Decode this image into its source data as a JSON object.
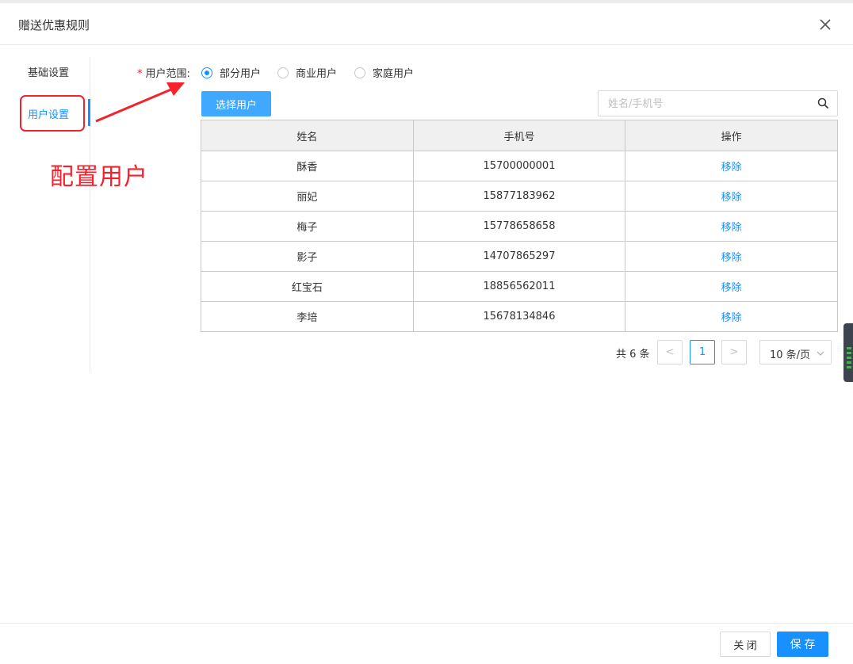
{
  "dialog": {
    "title": "赠送优惠规则",
    "close_icon": "close-icon"
  },
  "tabs": [
    {
      "label": "基础设置",
      "active": false
    },
    {
      "label": "用户设置",
      "active": true
    }
  ],
  "annotation": {
    "text": "配置用户",
    "color": "#f5222d"
  },
  "scope": {
    "required_mark": "*",
    "label": "用户范围:",
    "options": [
      {
        "label": "部分用户",
        "checked": true
      },
      {
        "label": "商业用户",
        "checked": false
      },
      {
        "label": "家庭用户",
        "checked": false
      }
    ]
  },
  "toolbar": {
    "select_user_label": "选择用户",
    "search_placeholder": "姓名/手机号",
    "search_icon": "search-icon"
  },
  "table": {
    "headers": [
      "姓名",
      "手机号",
      "操作"
    ],
    "rows": [
      {
        "name": "酥香",
        "phone": "15700000001",
        "action": "移除"
      },
      {
        "name": "丽妃",
        "phone": "15877183962",
        "action": "移除"
      },
      {
        "name": "梅子",
        "phone": "15778658658",
        "action": "移除"
      },
      {
        "name": "影子",
        "phone": "14707865297",
        "action": "移除"
      },
      {
        "name": "红宝石",
        "phone": "18856562011",
        "action": "移除"
      },
      {
        "name": "李培",
        "phone": "15678134846",
        "action": "移除"
      }
    ]
  },
  "pagination": {
    "total_text": "共 6 条",
    "prev": "<",
    "current_page": "1",
    "next": ">",
    "page_size": "10 条/页"
  },
  "footer": {
    "close_label": "关 闭",
    "save_label": "保 存"
  },
  "colors": {
    "primary": "#1890ff",
    "button_light": "#40a9ff",
    "annotation_red": "#f5222d"
  }
}
